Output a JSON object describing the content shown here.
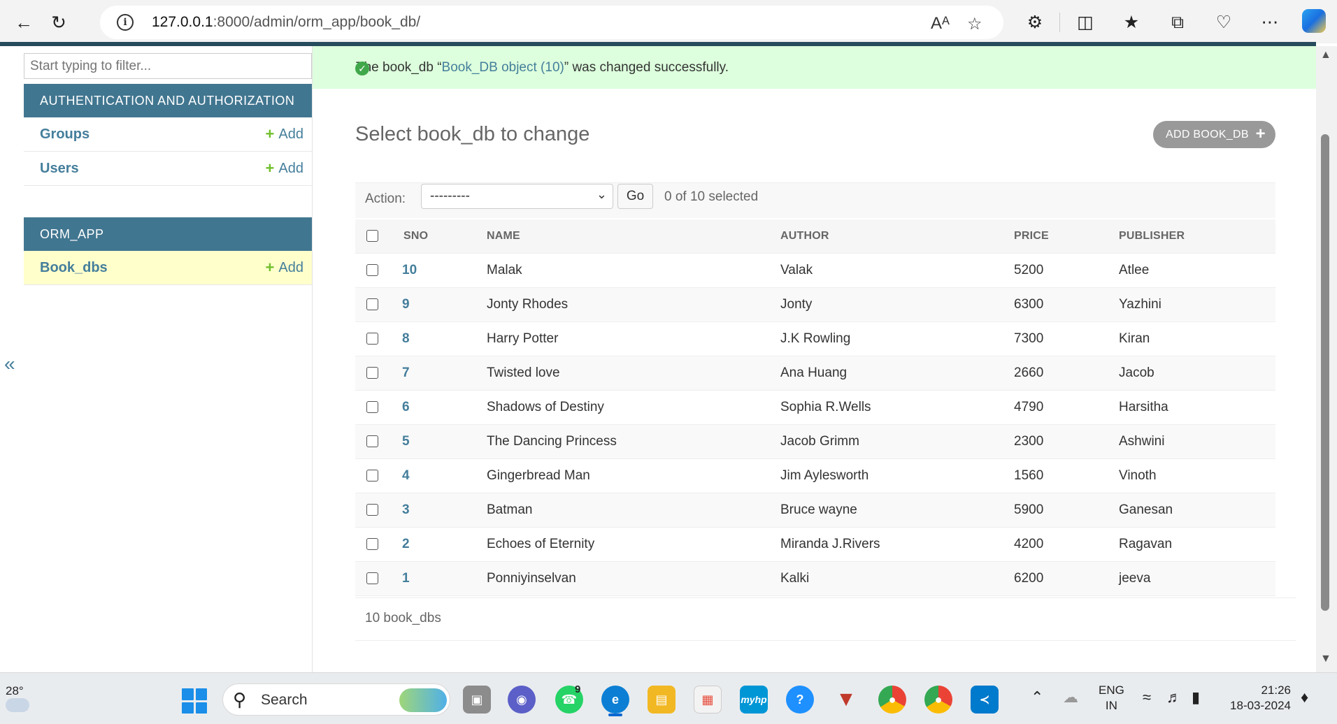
{
  "browser": {
    "url_host": "127.0.0.1",
    "url_path": ":8000/admin/orm_app/book_db/",
    "read_aloud_label": "Aᴬ"
  },
  "sidebar": {
    "filter_placeholder": "Start typing to filter...",
    "modules": [
      {
        "caption": "AUTHENTICATION AND AUTHORIZATION",
        "models": [
          {
            "name": "Groups",
            "add_label": "Add"
          },
          {
            "name": "Users",
            "add_label": "Add"
          }
        ]
      },
      {
        "caption": "ORM_APP",
        "models": [
          {
            "name": "Book_dbs",
            "add_label": "Add"
          }
        ]
      }
    ],
    "collapse_label": "«"
  },
  "message": {
    "prefix": "The book_db “",
    "object_link": "Book_DB object (10)",
    "suffix": "” was changed successfully."
  },
  "page": {
    "title": "Select book_db to change",
    "add_button": "ADD BOOK_DB"
  },
  "actions": {
    "label": "Action:",
    "selected_value": "---------",
    "go_label": "Go",
    "counter": "0 of 10 selected"
  },
  "table": {
    "headers": [
      "SNO",
      "NAME",
      "AUTHOR",
      "PRICE",
      "PUBLISHER"
    ],
    "rows": [
      {
        "sno": "10",
        "name": "Malak",
        "author": "Valak",
        "price": "5200",
        "publisher": "Atlee"
      },
      {
        "sno": "9",
        "name": "Jonty Rhodes",
        "author": "Jonty",
        "price": "6300",
        "publisher": "Yazhini"
      },
      {
        "sno": "8",
        "name": "Harry Potter",
        "author": "J.K Rowling",
        "price": "7300",
        "publisher": "Kiran"
      },
      {
        "sno": "7",
        "name": "Twisted love",
        "author": "Ana Huang",
        "price": "2660",
        "publisher": "Jacob"
      },
      {
        "sno": "6",
        "name": "Shadows of Destiny",
        "author": "Sophia R.Wells",
        "price": "4790",
        "publisher": "Harsitha"
      },
      {
        "sno": "5",
        "name": "The Dancing Princess",
        "author": "Jacob Grimm",
        "price": "2300",
        "publisher": "Ashwini"
      },
      {
        "sno": "4",
        "name": "Gingerbread Man",
        "author": "Jim Aylesworth",
        "price": "1560",
        "publisher": "Vinoth"
      },
      {
        "sno": "3",
        "name": "Batman",
        "author": "Bruce wayne",
        "price": "5900",
        "publisher": "Ganesan"
      },
      {
        "sno": "2",
        "name": "Echoes of Eternity",
        "author": "Miranda J.Rivers",
        "price": "4200",
        "publisher": "Ragavan"
      },
      {
        "sno": "1",
        "name": "Ponniyinselvan",
        "author": "Kalki",
        "price": "6200",
        "publisher": "jeeva"
      }
    ]
  },
  "paginator": "10 book_dbs",
  "taskbar": {
    "weather_temp": "28°",
    "search_label": "Search",
    "whatsapp_badge": "9",
    "hp_label": "myhp",
    "lang_top": "ENG",
    "lang_bottom": "IN",
    "time": "21:26",
    "date": "18-03-2024"
  },
  "colors": {
    "header_blue": "#417690",
    "link_blue": "#447e9b",
    "success_bg": "#dddddd",
    "add_green": "#70bf2b",
    "current_row": "#ffffcc"
  }
}
